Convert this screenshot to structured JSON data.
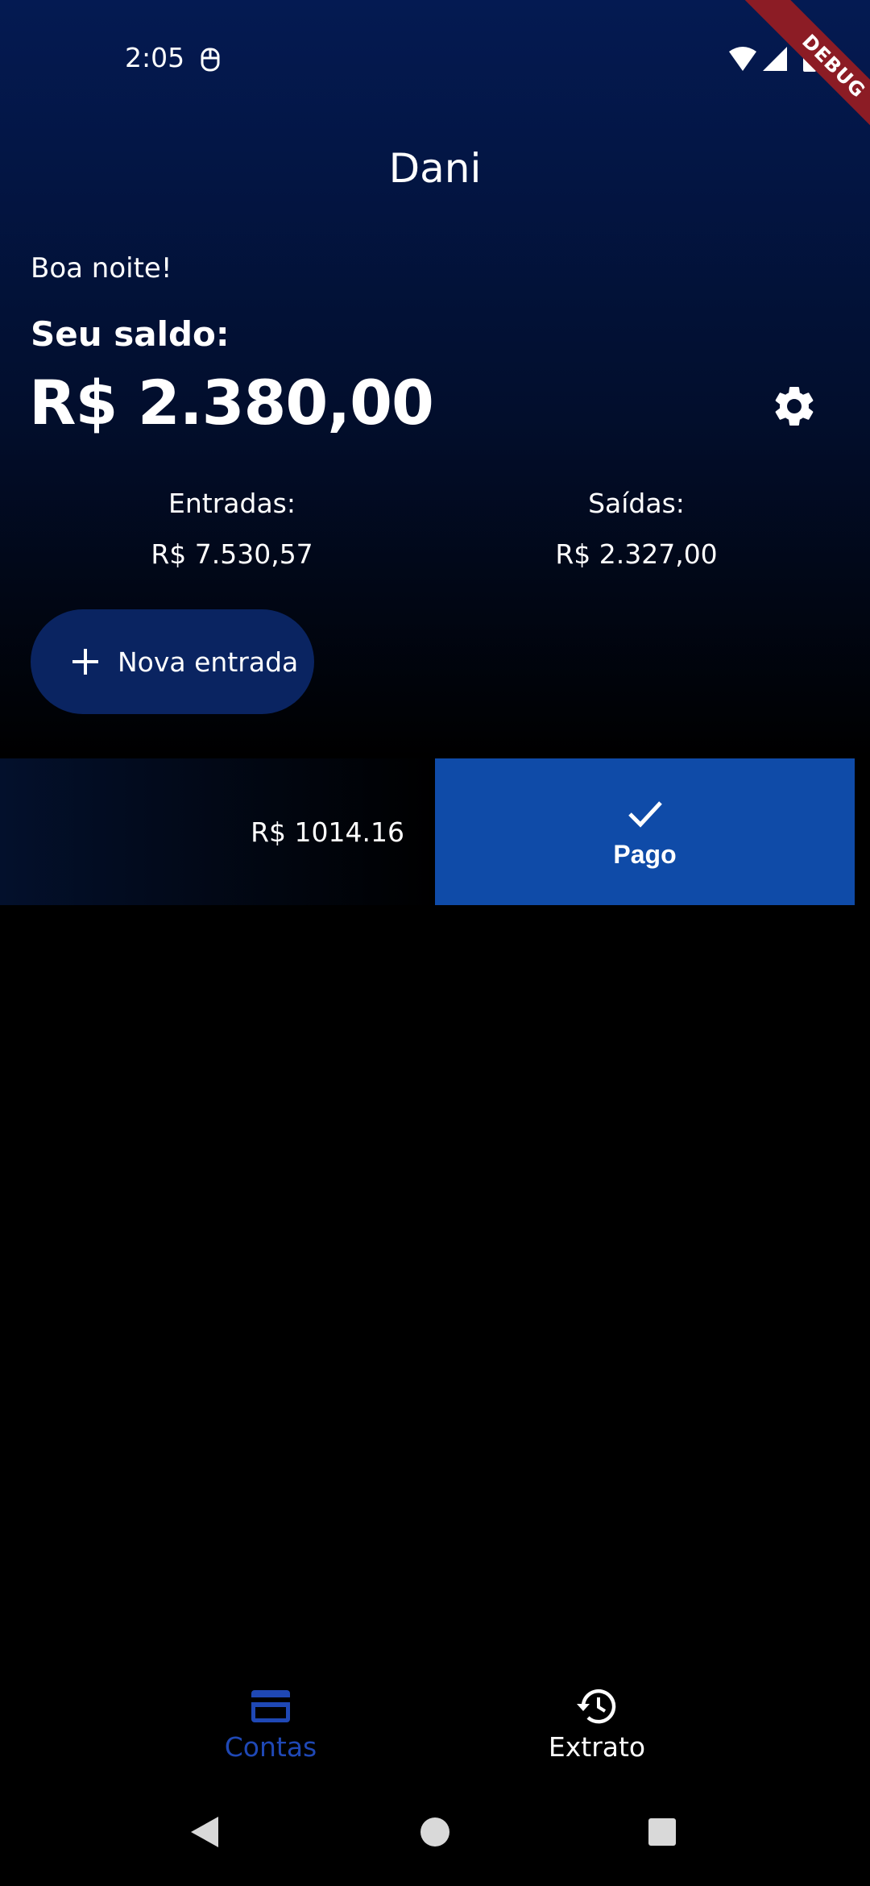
{
  "status_bar": {
    "time": "2:05",
    "icons": [
      "notification-icon",
      "wifi-icon",
      "signal-icon",
      "battery-icon"
    ]
  },
  "debug_banner": "DEBUG",
  "header": {
    "title": "Dani"
  },
  "summary": {
    "greeting": "Boa noite!",
    "balance_label": "Seu saldo:",
    "balance_value": "R$ 2.380,00",
    "settings_icon": "gear-icon",
    "income_label": "Entradas:",
    "income_value": "R$ 7.530,57",
    "expense_label": "Saídas:",
    "expense_value": "R$ 2.327,00"
  },
  "new_entry_button": {
    "label": "Nova entrada",
    "icon": "plus-icon"
  },
  "list": {
    "items": [
      {
        "amount": "R$ 1014.16",
        "swipe_action_label": "Pago",
        "swipe_action_icon": "check-icon"
      }
    ]
  },
  "bottom_nav": {
    "items": [
      {
        "label": "Contas",
        "icon": "credit-card-icon",
        "active": true
      },
      {
        "label": "Extrato",
        "icon": "history-icon",
        "active": false
      }
    ]
  },
  "colors": {
    "active_nav": "#1f48b5",
    "paid_action": "#0f4ba8",
    "button_bg": "#0a2461",
    "header_gradient_top": "#041a52"
  }
}
